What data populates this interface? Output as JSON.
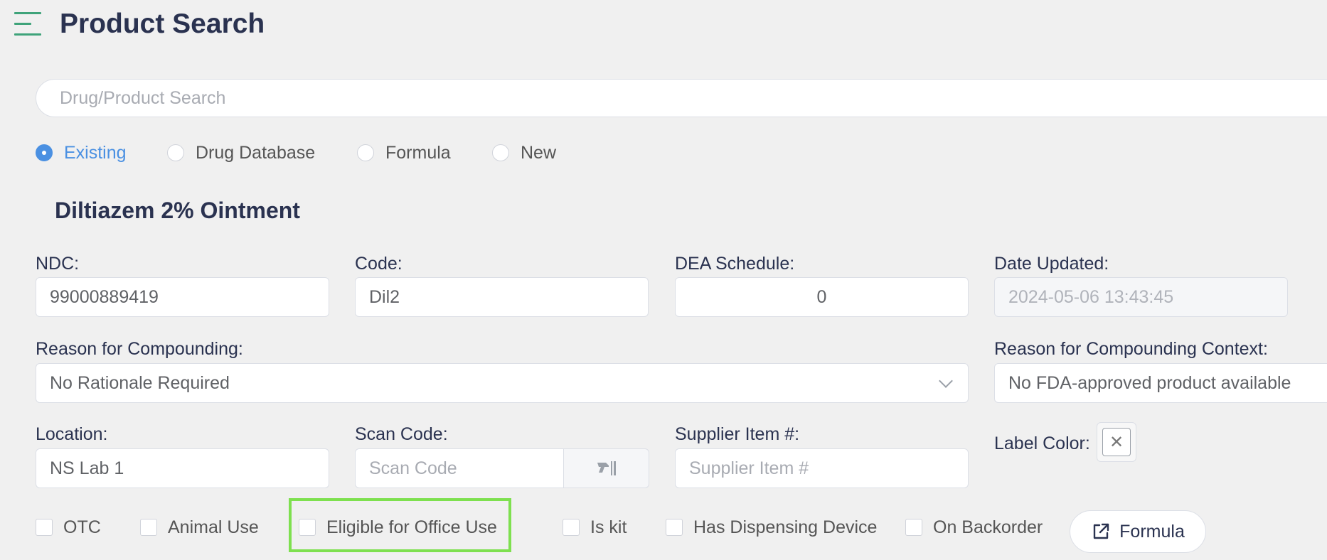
{
  "header": {
    "title": "Product Search",
    "menu_icon": "hamburger-menu-icon"
  },
  "search": {
    "placeholder": "Drug/Product Search",
    "value": ""
  },
  "source_options": [
    {
      "label": "Existing",
      "selected": true
    },
    {
      "label": "Drug Database",
      "selected": false
    },
    {
      "label": "Formula",
      "selected": false
    },
    {
      "label": "New",
      "selected": false
    }
  ],
  "product": {
    "name": "Diltiazem 2% Ointment"
  },
  "fields": {
    "ndc": {
      "label": "NDC:",
      "value": "99000889419"
    },
    "code": {
      "label": "Code:",
      "value": "Dil2"
    },
    "dea_schedule": {
      "label": "DEA Schedule:",
      "value": "0"
    },
    "date_updated": {
      "label": "Date Updated:",
      "value": "2024-05-06 13:43:45"
    },
    "reason": {
      "label": "Reason for Compounding:",
      "value": "No Rationale Required"
    },
    "reason_context": {
      "label": "Reason for Compounding Context:",
      "value": "No FDA-approved product available"
    },
    "location": {
      "label": "Location:",
      "value": "NS Lab 1"
    },
    "scan_code": {
      "label": "Scan Code:",
      "placeholder": "Scan Code",
      "icon": "barcode-scanner-icon"
    },
    "supplier_item": {
      "label": "Supplier Item #:",
      "placeholder": "Supplier Item #"
    },
    "label_color": {
      "label": "Label Color:",
      "value_icon": "close-icon"
    }
  },
  "flags": [
    {
      "label": "OTC",
      "checked": false
    },
    {
      "label": "Animal Use",
      "checked": false
    },
    {
      "label": "Eligible for Office Use",
      "checked": false,
      "highlighted": true
    },
    {
      "label": "Is kit",
      "checked": false
    },
    {
      "label": "Has Dispensing Device",
      "checked": false
    },
    {
      "label": "On Backorder",
      "checked": false
    }
  ],
  "actions": {
    "formula_label": "Formula",
    "formula_icon": "external-link-icon"
  },
  "colors": {
    "accent": "#4a90e2",
    "highlight": "#7ee04f",
    "menu": "#3fa37a",
    "title": "#2a3250"
  }
}
